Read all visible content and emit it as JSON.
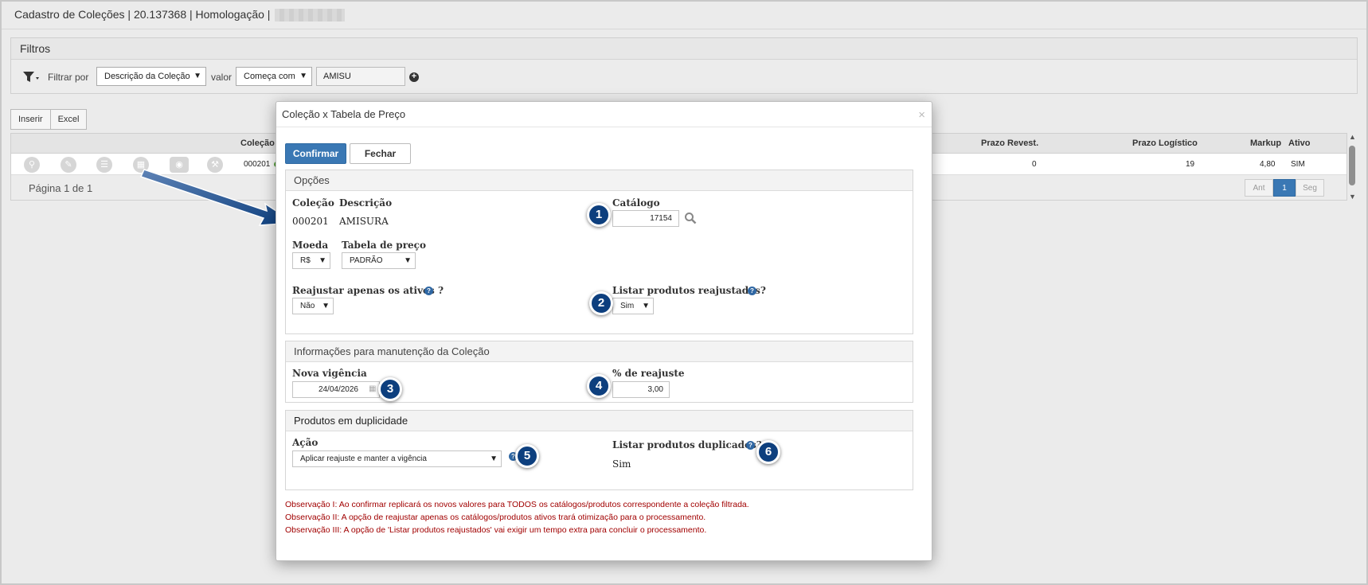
{
  "page": {
    "title": "Cadastro de Coleções | 20.137368 | Homologação |"
  },
  "filters": {
    "title": "Filtros",
    "filter_by_label": "Filtrar por",
    "filter_by_value": "Descrição da Coleção",
    "value_label": "valor",
    "operator_value": "Começa com",
    "search_value": "AMISU"
  },
  "actions": {
    "insert_label": "Inserir",
    "excel_label": "Excel"
  },
  "grid": {
    "headers": {
      "colecao": "Coleção",
      "prazo_revest": "Prazo Revest.",
      "prazo_logistico": "Prazo Logístico",
      "markup": "Markup",
      "ativo": "Ativo"
    },
    "row": {
      "codigo": "000201",
      "prazo_revest": "0",
      "prazo_logistico": "19",
      "markup": "4,80",
      "ativo": "SIM"
    },
    "row_icons": [
      "search-icon",
      "edit-icon",
      "list-icon",
      "table-icon",
      "money-icon",
      "wrench-icon"
    ],
    "page_info": "Página 1 de 1",
    "pager": {
      "prev": "Ant",
      "current": "1",
      "next": "Seg"
    }
  },
  "modal": {
    "title": "Coleção x Tabela de Preço",
    "close": "×",
    "confirm_label": "Confirmar",
    "close_label": "Fechar",
    "opcoes": {
      "title": "Opções",
      "colecao_label": "Coleção",
      "colecao_value": "000201",
      "descricao_label": "Descrição",
      "descricao_value": "AMISURA",
      "catalogo_label": "Catálogo",
      "catalogo_value": "17154",
      "moeda_label": "Moeda",
      "moeda_value": "R$",
      "tabela_label": "Tabela de preço",
      "tabela_value": "PADRÃO",
      "reajustar_label": "Reajustar apenas os ativos ?",
      "reajustar_value": "Não",
      "listar_reaj_label": "Listar produtos reajustados?",
      "listar_reaj_value": "Sim"
    },
    "manutencao": {
      "title": "Informações para manutenção da Coleção",
      "vigencia_label": "Nova vigência",
      "vigencia_value": "24/04/2026",
      "reajuste_label": "% de reajuste",
      "reajuste_value": "3,00"
    },
    "duplicidade": {
      "title": "Produtos em duplicidade",
      "acao_label": "Ação",
      "acao_value": "Aplicar reajuste e manter a vigência",
      "listar_dup_label": "Listar produtos duplicados?",
      "listar_dup_value": "Sim"
    },
    "observacoes": [
      "Observação I: Ao confirmar replicará os novos valores para TODOS os catálogos/produtos correspondente a coleção filtrada.",
      "Observação II: A opção de reajustar apenas os catálogos/produtos ativos trará otimização para o processamento.",
      "Observação III: A opção de 'Listar produtos reajustados' vai exigir um tempo extra para concluir o processamento."
    ],
    "badges": [
      "1",
      "2",
      "3",
      "4",
      "5",
      "6"
    ]
  },
  "colors": {
    "primary": "#3a78b4",
    "badge": "#0d3f7e",
    "observation": "#a10000",
    "status_active": "#5aa33f"
  }
}
